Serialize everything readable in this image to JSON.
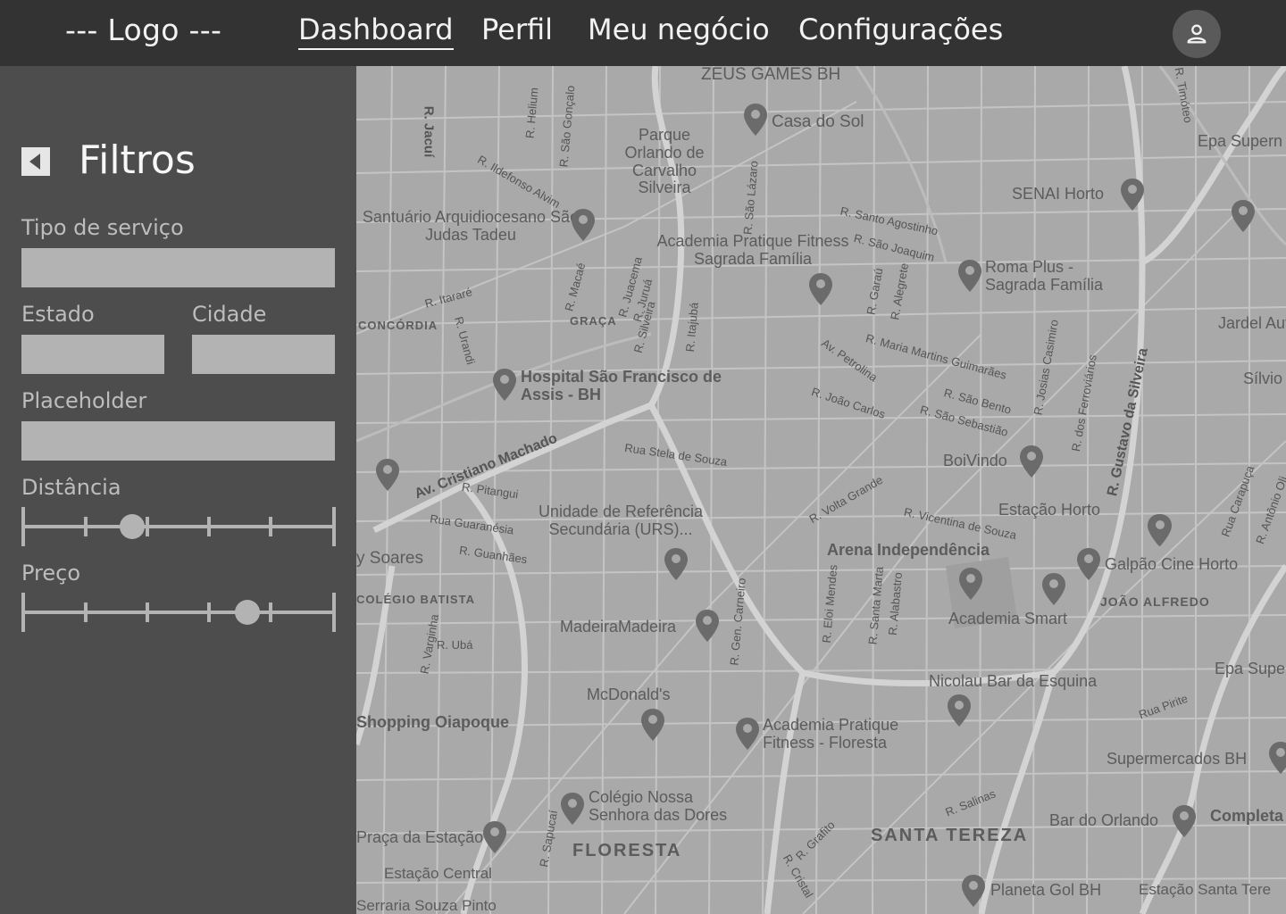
{
  "header": {
    "logo": "--- Logo ---",
    "nav": [
      {
        "label": "Dashboard",
        "active": true
      },
      {
        "label": "Perfil",
        "active": false
      },
      {
        "label": "Meu negócio",
        "active": false
      },
      {
        "label": "Configurações",
        "active": false
      }
    ],
    "avatar_icon": "user-icon"
  },
  "sidebar": {
    "title": "Filtros",
    "back_icon": "triangle-left-icon",
    "fields": {
      "tipo_label": "Tipo de serviço",
      "estado_label": "Estado",
      "cidade_label": "Cidade",
      "placeholder_label": "Placeholder",
      "distancia_label": "Distância",
      "preco_label": "Preço"
    },
    "distancia_value": 0.35,
    "preco_value": 0.72
  },
  "map": {
    "places": [
      "ZEUS GAMES BH",
      "Casa do Sol",
      "Parque Orlando de Carvalho Silveira",
      "Santuário Arquidiocesano São Judas Tadeu",
      "SENAI Horto",
      "Epa Supern",
      "Academia Pratique Fitness Sagrada Família",
      "Roma Plus - Sagrada Família",
      "Jardel Auto",
      "Sílvio",
      "Hospital São Francisco de Assis - BH",
      "BoiVindo",
      "Estação Horto",
      "Arena Independência",
      "Galpão Cine Horto",
      "Unidade de Referência Secundária (URS)...",
      "Academia Smart",
      "JOÃO ALFREDO",
      "MadeiraMadeira",
      "Epa Super",
      "Nicolau Bar da Esquina",
      "McDonald's",
      "Shopping Oiapoque",
      "Academia Pratique Fitness - Floresta",
      "Supermercados BH",
      "Colégio Nossa Senhora das Dores",
      "FLORESTA",
      "SANTA TEREZA",
      "Bar do Orlando",
      "Completa",
      "Praça da Estação",
      "Estação Central",
      "Planeta Gol BH",
      "Estação Santa Tere",
      "Serraria Souza Pinto",
      "CONCÓRDIA",
      "GRAÇA",
      "COLÉGIO BATISTA",
      "y Soares"
    ],
    "streets": [
      "Av. Cristiano Machado",
      "Rua Stela de Souza",
      "R. Pitangui",
      "Rua Guaranésia",
      "R. Guanhães",
      "R. Santo Agostinho",
      "R. São Joaquim",
      "R. Maria Martins Guimarães",
      "R. São Bento",
      "R. São Sebastião",
      "Av. Petrolina",
      "R. João Carlos",
      "R. Volta Grande",
      "R. Vicentina de Souza",
      "R. Gustavo da Silveira",
      "R. Itararé",
      "R. Urandi",
      "R. Jacuí",
      "R. Salinas",
      "R. Grafito",
      "R. Cristal",
      "Rua Pirite",
      "R. Ubá",
      "R. Varginha",
      "R. Gen. Carneiro",
      "R. Eloi Mendes",
      "R. Santa Marta",
      "R. Alabastro",
      "R. Itajubá",
      "R. Macaé",
      "R. Juacema",
      "R. Juruá",
      "R. Silveira",
      "R. São Lázaro",
      "R. Garaú",
      "R. Alegrete",
      "R. Josias Casimiro",
      "R. dos Ferroviários",
      "R. Timóteo",
      "R. Ildefonso Alvim",
      "R. Helium",
      "R. São Gonçalo",
      "R. Sapucaí",
      "Rua Carapuça",
      "R. Antônio Oli"
    ]
  }
}
